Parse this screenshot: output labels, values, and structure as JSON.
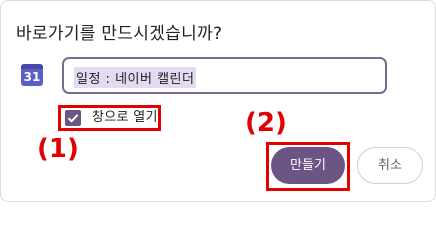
{
  "dialog": {
    "title": "바로가기를 만드시겠습니까?",
    "app_icon": {
      "name": "calendar-app-icon",
      "number": "31",
      "color": "#5b5fc7"
    },
    "name_input": {
      "value": "일정 : 네이버 캘린더"
    },
    "open_in_window": {
      "label": "창으로 열기",
      "checked": true
    },
    "buttons": {
      "create": "만들기",
      "cancel": "취소"
    }
  },
  "annotations": {
    "label_1": "(1)",
    "label_2": "(2)",
    "color": "#e30000"
  },
  "colors": {
    "accent": "#6a5585",
    "selection": "#e3dcf0"
  }
}
